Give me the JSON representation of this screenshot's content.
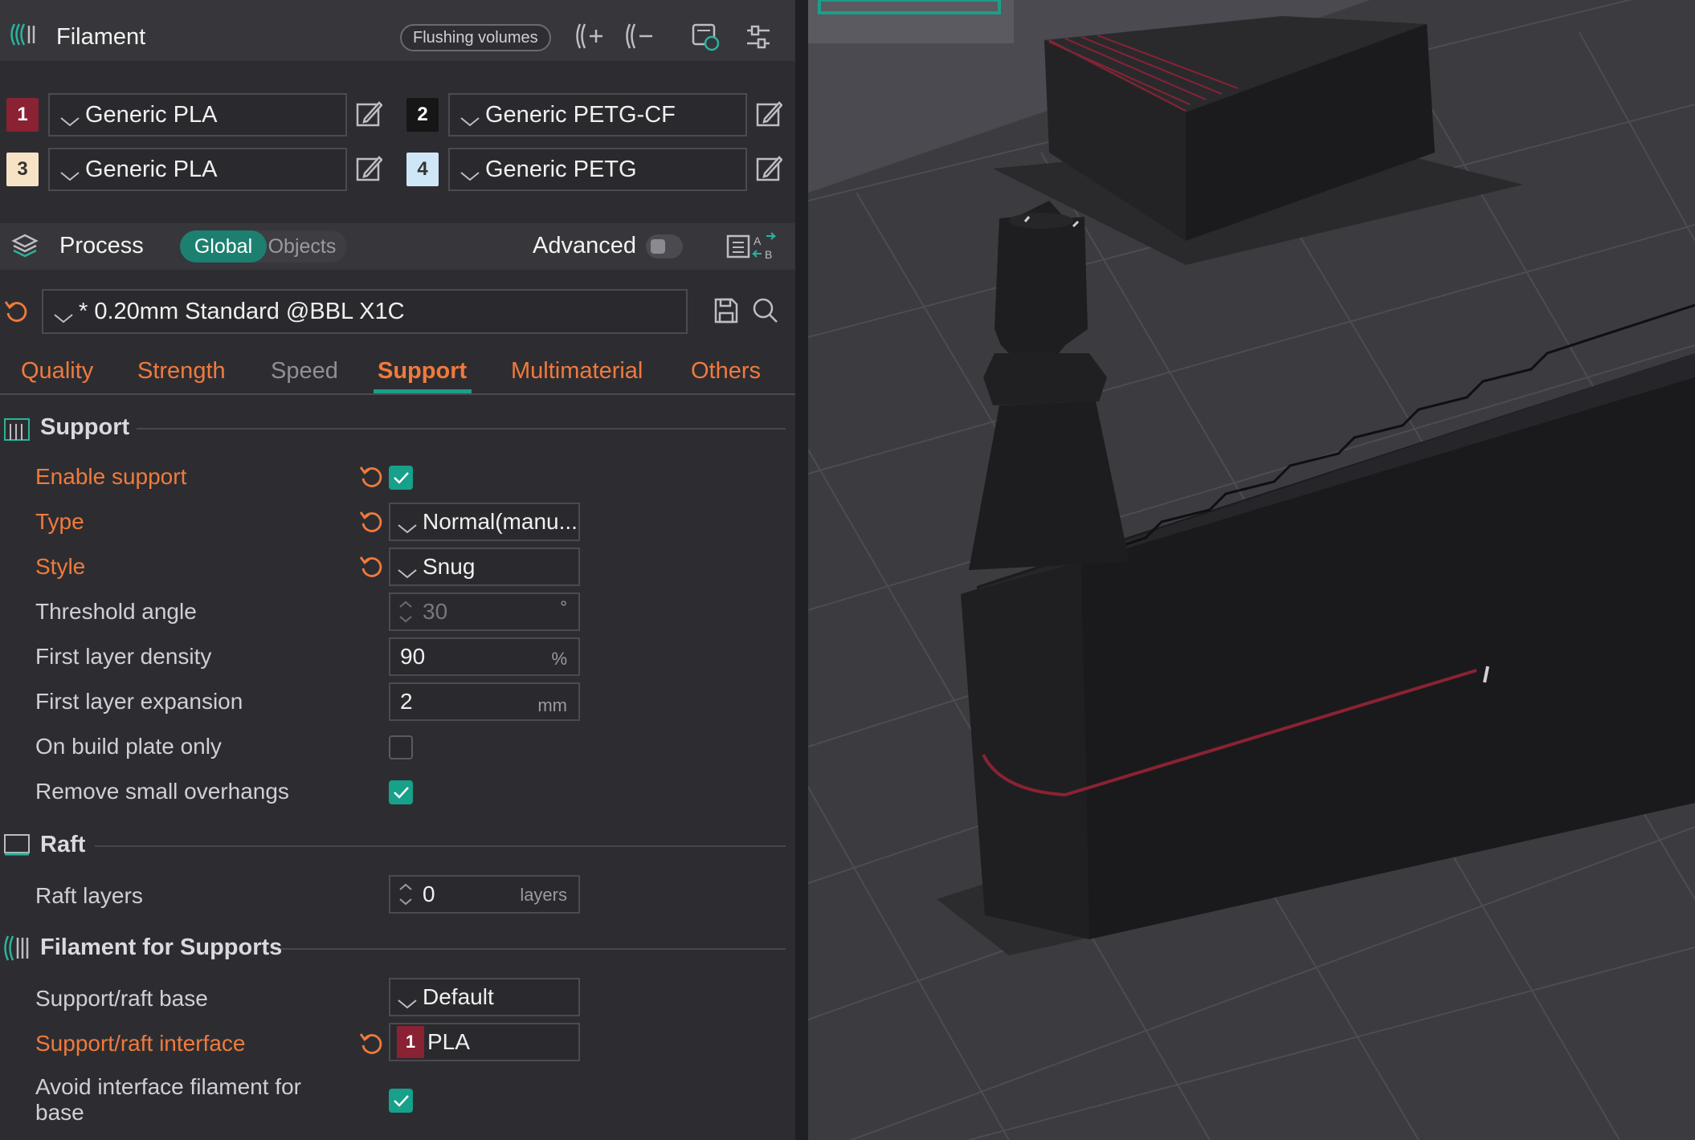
{
  "filament": {
    "title": "Filament",
    "flushing_button": "Flushing volumes",
    "slots": [
      {
        "num": "1",
        "name": "Generic PLA",
        "color": "#8a2233",
        "text_color": "#ffffff"
      },
      {
        "num": "2",
        "name": "Generic PETG-CF",
        "color": "#161616",
        "text_color": "#ffffff"
      },
      {
        "num": "3",
        "name": "Generic PLA",
        "color": "#f6e3c6",
        "text_color": "#333333"
      },
      {
        "num": "4",
        "name": "Generic PETG",
        "color": "#cfe6f6",
        "text_color": "#333333"
      }
    ]
  },
  "process": {
    "title": "Process",
    "scope_on": "Global",
    "scope_off": "Objects",
    "advanced_label": "Advanced",
    "preset": "* 0.20mm Standard @BBL X1C"
  },
  "tabs": [
    {
      "label": "Quality"
    },
    {
      "label": "Strength"
    },
    {
      "label": "Speed"
    },
    {
      "label": "Support"
    },
    {
      "label": "Multimaterial"
    },
    {
      "label": "Others"
    }
  ],
  "support": {
    "title": "Support",
    "enable_label": "Enable support",
    "type_label": "Type",
    "type_value": "Normal(manu...",
    "style_label": "Style",
    "style_value": "Snug",
    "threshold_label": "Threshold angle",
    "threshold_value": "30",
    "threshold_unit": "°",
    "first_density_label": "First layer density",
    "first_density_value": "90",
    "first_density_unit": "%",
    "first_expansion_label": "First layer expansion",
    "first_expansion_value": "2",
    "first_expansion_unit": "mm",
    "build_plate_label": "On build plate only",
    "overhangs_label": "Remove small overhangs"
  },
  "raft": {
    "title": "Raft",
    "layers_label": "Raft layers",
    "layers_value": "0",
    "layers_unit": "layers"
  },
  "filament_supports": {
    "title": "Filament for Supports",
    "base_label": "Support/raft base",
    "base_value": "Default",
    "interface_label": "Support/raft interface",
    "interface_num": "1",
    "interface_value": "PLA",
    "avoid_label_1": "Avoid interface filament for",
    "avoid_label_2": "base"
  },
  "colors": {
    "accent": "#1d9e8a",
    "modified": "#f07a3c",
    "filament_red": "#8a2233"
  }
}
